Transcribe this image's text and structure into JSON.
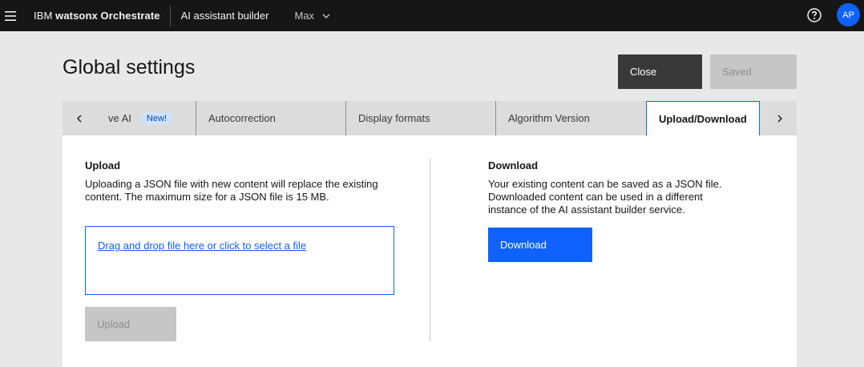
{
  "topbar": {
    "brand_prefix": "IBM ",
    "brand_name": "watsonx Orchestrate",
    "product": "AI assistant builder",
    "instance": "Max",
    "avatar_initials": "AP"
  },
  "header": {
    "title": "Global settings",
    "close_label": "Close",
    "saved_label": "Saved"
  },
  "tabs": [
    {
      "label": "ve AI",
      "badge": "New!"
    },
    {
      "label": "Autocorrection"
    },
    {
      "label": "Display formats"
    },
    {
      "label": "Algorithm Version"
    },
    {
      "label": "Upload/Download",
      "active": true
    }
  ],
  "upload": {
    "title": "Upload",
    "description_line1": "Uploading a JSON file with new content will replace the existing",
    "description_line2": "content. The maximum size for a JSON file is 15 MB.",
    "dropzone_text": "Drag and drop file here or click to select a file",
    "button_label": "Upload"
  },
  "download": {
    "title": "Download",
    "description_line1": "Your existing content can be saved as a JSON file.",
    "description_line2": "Downloaded content can be used in a different",
    "description_line3": "instance of the AI assistant builder service.",
    "button_label": "Download"
  },
  "colors": {
    "primary": "#0f62fe",
    "topbar": "#161616",
    "badge_bg": "#d0e2ff"
  },
  "icons": [
    "menu-icon",
    "chevron-down-icon",
    "help-icon",
    "chevron-left-icon",
    "chevron-right-icon"
  ]
}
